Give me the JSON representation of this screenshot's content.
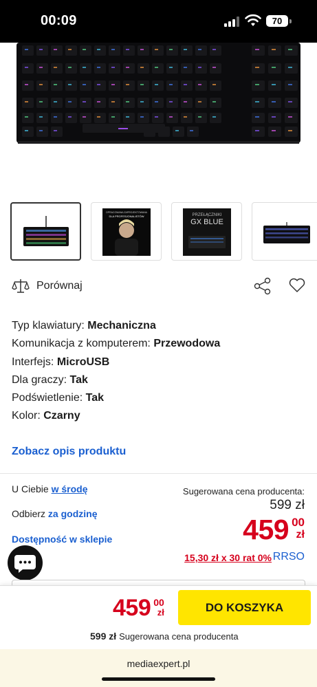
{
  "status_bar": {
    "time": "00:09",
    "battery": "70"
  },
  "product": {
    "thumbnails": [
      {
        "name": "keyboard-front",
        "alt_text": ""
      },
      {
        "name": "promo-person",
        "alt_text": "OPRACOWANA ZAPROJEKTOWANA DLA PROFESJONALISTÓW"
      },
      {
        "name": "switches",
        "alt_text": "PRZEŁĄCZNIKI GX BLUE"
      },
      {
        "name": "keyboard-angled",
        "alt_text": ""
      }
    ],
    "compare_label": "Porównaj",
    "specs": [
      {
        "label": "Typ klawiatury:",
        "value": "Mechaniczna"
      },
      {
        "label": "Komunikacja z komputerem:",
        "value": "Przewodowa"
      },
      {
        "label": "Interfejs:",
        "value": "MicroUSB"
      },
      {
        "label": "Dla graczy:",
        "value": "Tak"
      },
      {
        "label": "Podświetlenie:",
        "value": "Tak"
      },
      {
        "label": "Kolor:",
        "value": "Czarny"
      }
    ],
    "description_link": "Zobacz opis produktu"
  },
  "delivery": {
    "prefix": "U Ciebie",
    "day": "w środę",
    "pickup_prefix": "Odbierz",
    "pickup_time": "za godzinę",
    "availability_link": "Dostępność w sklepie"
  },
  "pricing": {
    "suggested_label": "Sugerowana cena producenta:",
    "old_price": "599 zł",
    "price_int": "459",
    "price_cents": "00",
    "currency": "zł",
    "installments": "15,30 zł x 30 rat 0%",
    "rrso": "RRSO"
  },
  "bottom_bar": {
    "price_int": "459",
    "price_cents": "00",
    "currency": "zł",
    "cart_button": "DO KOSZYKA",
    "suggested_amount": "599 zł",
    "suggested_text": "Sugerowana cena producenta"
  },
  "browser": {
    "url": "mediaexpert.pl"
  },
  "colors": {
    "accent_blue": "#1a5fd0",
    "price_red": "#d6001c",
    "cart_yellow": "#ffe500"
  }
}
